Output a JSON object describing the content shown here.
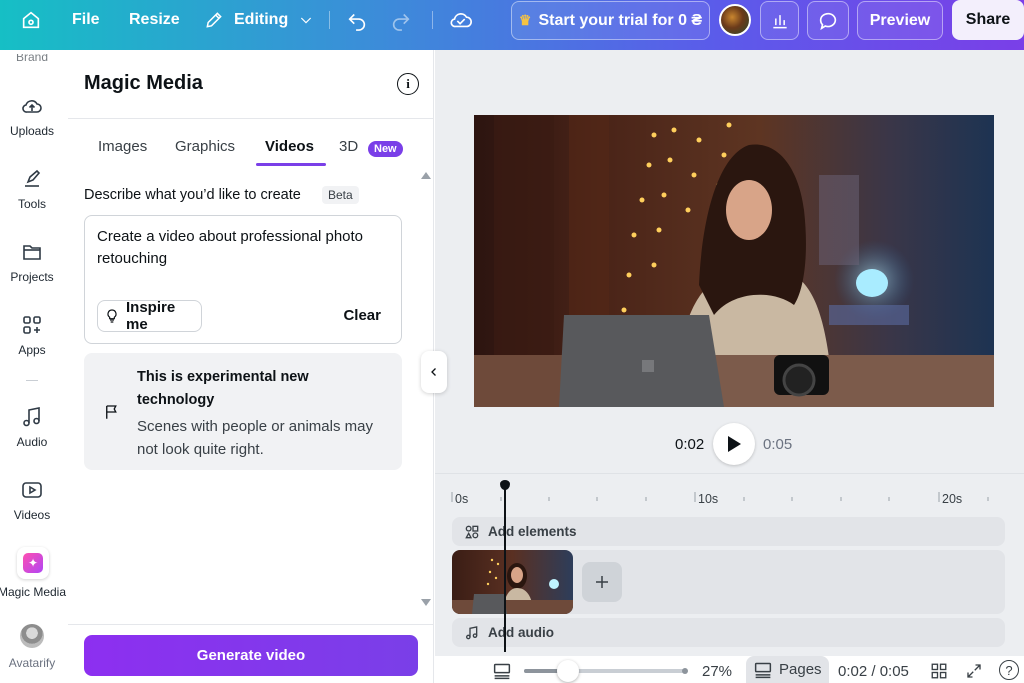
{
  "topbar": {
    "file_label": "File",
    "resize_label": "Resize",
    "editing_label": "Editing",
    "trial_label": "Start your trial for 0 ₴",
    "preview_label": "Preview",
    "share_label": "Share"
  },
  "rail": {
    "items": [
      {
        "label": "Brand",
        "icon": "brand-icon"
      },
      {
        "label": "Uploads",
        "icon": "cloud-upload-icon"
      },
      {
        "label": "Tools",
        "icon": "pen-icon"
      },
      {
        "label": "Projects",
        "icon": "folder-icon"
      },
      {
        "label": "Apps",
        "icon": "apps-icon"
      },
      {
        "label": "Audio",
        "icon": "music-note-icon"
      },
      {
        "label": "Videos",
        "icon": "video-play-icon"
      },
      {
        "label": "Magic Media",
        "icon": "magic-media-icon"
      },
      {
        "label": "Avatarify",
        "icon": "avatar-icon"
      }
    ]
  },
  "panel": {
    "title": "Magic Media",
    "tabs": [
      {
        "label": "Images"
      },
      {
        "label": "Graphics"
      },
      {
        "label": "Videos"
      },
      {
        "label": "3D"
      }
    ],
    "new_badge": "New",
    "describe_label": "Describe what you’d like to create",
    "beta_badge": "Beta",
    "prompt_text": "Create a video about professional photo retouching",
    "inspire_label": "Inspire me",
    "clear_label": "Clear",
    "notice_title": "This is experimental new technology",
    "notice_body": "Scenes with people or animals may not look quite right.",
    "generate_label": "Generate video"
  },
  "player": {
    "current_time": "0:02",
    "total_time": "0:05"
  },
  "timeline": {
    "ruler": [
      "0s",
      "10s",
      "20s"
    ],
    "add_elements_label": "Add elements",
    "add_audio_label": "Add audio"
  },
  "footer": {
    "zoom": "27%",
    "pages_label": "Pages",
    "time_readout": "0:02 / 0:05",
    "help": "?"
  },
  "colors": {
    "accent_purple": "#7a3fe8",
    "topbar_start": "#16bfc5",
    "topbar_end": "#7a3fe8"
  }
}
